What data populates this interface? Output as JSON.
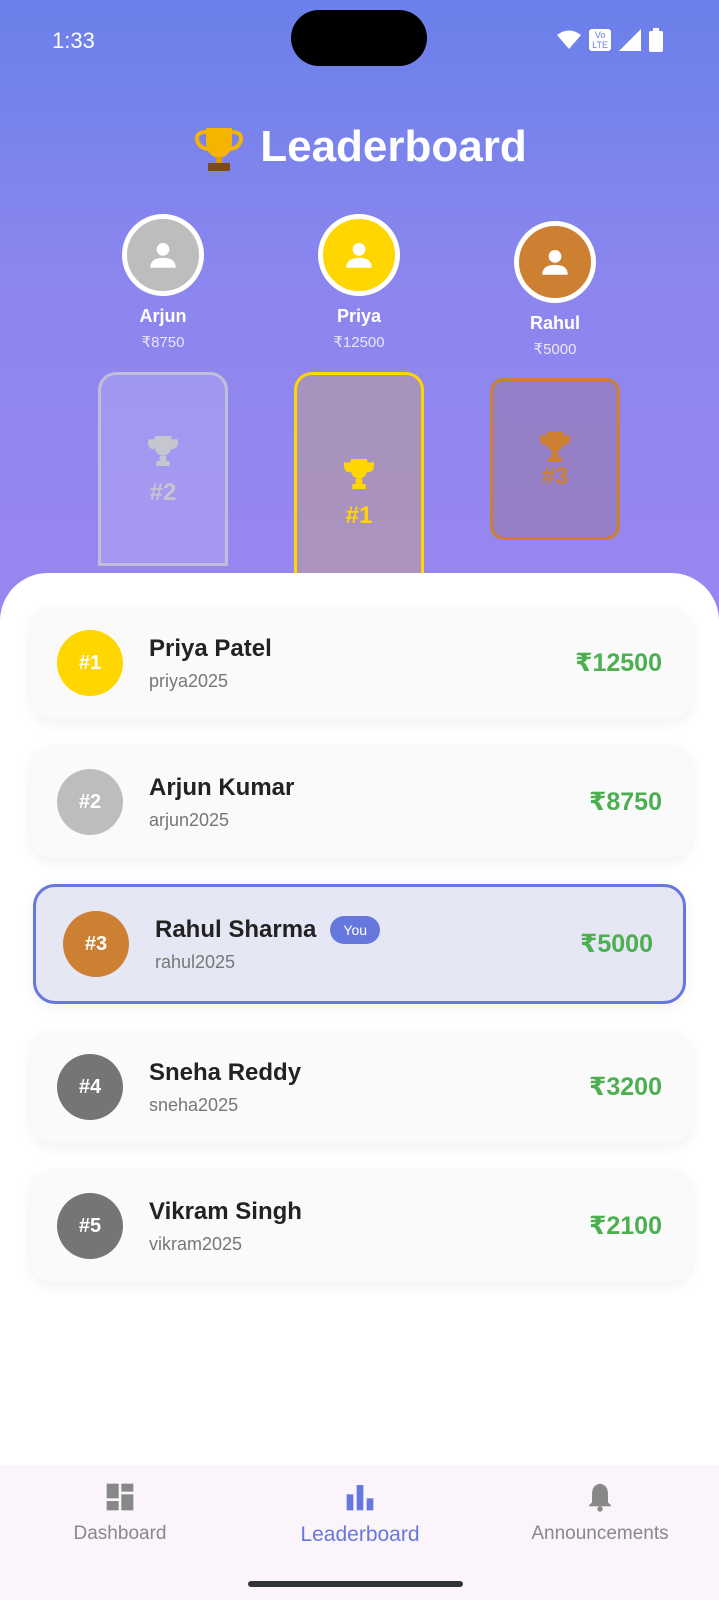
{
  "status": {
    "time": "1:33",
    "volte_line1": "Vo",
    "volte_line2": "LTE"
  },
  "header": {
    "title": "Leaderboard",
    "icon": "trophy-icon"
  },
  "podium": {
    "second": {
      "name": "Arjun",
      "score": "₹8750",
      "rank": "#2",
      "color": "#bdbdbd"
    },
    "first": {
      "name": "Priya",
      "score": "₹12500",
      "rank": "#1",
      "color": "#ffd600"
    },
    "third": {
      "name": "Rahul",
      "score": "₹5000",
      "rank": "#3",
      "color": "#cd7f32"
    }
  },
  "leaders": [
    {
      "rank": "#1",
      "name": "Priya Patel",
      "username": "priya2025",
      "amount": "₹12500",
      "color": "#ffd600"
    },
    {
      "rank": "#2",
      "name": "Arjun Kumar",
      "username": "arjun2025",
      "amount": "₹8750",
      "color": "#bdbdbd"
    },
    {
      "rank": "#3",
      "name": "Rahul Sharma",
      "username": "rahul2025",
      "amount": "₹5000",
      "color": "#cd7f32",
      "badge": "You"
    },
    {
      "rank": "#4",
      "name": "Sneha Reddy",
      "username": "sneha2025",
      "amount": "₹3200",
      "color": "#757575"
    },
    {
      "rank": "#5",
      "name": "Vikram Singh",
      "username": "vikram2025",
      "amount": "₹2100",
      "color": "#757575"
    }
  ],
  "nav": {
    "dashboard": "Dashboard",
    "leaderboard": "Leaderboard",
    "announcements": "Announcements",
    "active": "leaderboard"
  },
  "colors": {
    "accent": "#6678dd",
    "amount": "#4caf50"
  }
}
